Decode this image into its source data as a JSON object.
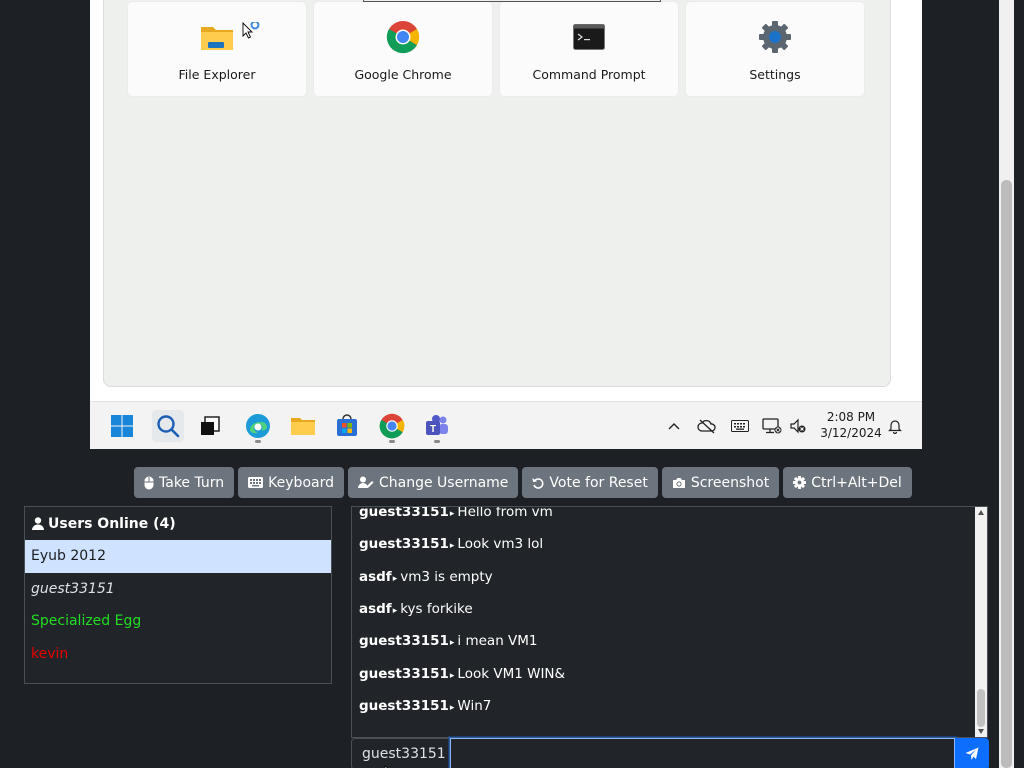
{
  "vm": {
    "pinned_apps": [
      {
        "label": "File Explorer",
        "icon": "folder-icon"
      },
      {
        "label": "Google Chrome",
        "icon": "chrome-icon"
      },
      {
        "label": "Command Prompt",
        "icon": "terminal-icon"
      },
      {
        "label": "Settings",
        "icon": "gear-icon"
      }
    ],
    "taskbar": {
      "icons": [
        "windows-start-icon",
        "search-icon",
        "task-view-icon",
        "edge-icon",
        "file-explorer-icon",
        "store-icon",
        "chrome-icon",
        "teams-icon"
      ],
      "tray_icons": [
        "chevron-up-icon",
        "cloud-off-icon",
        "keyboard-icon",
        "network-icon",
        "volume-muted-icon"
      ],
      "time": "2:08 PM",
      "date": "3/12/2024",
      "notification_icon": "bell-icon"
    }
  },
  "controls": {
    "take_turn": "Take Turn",
    "keyboard": "Keyboard",
    "change_username": "Change Username",
    "vote_reset": "Vote for Reset",
    "screenshot": "Screenshot",
    "ctrl_alt_del": "Ctrl+Alt+Del"
  },
  "users": {
    "header": "Users Online (4)",
    "list": [
      {
        "name": "Eyub 2012"
      },
      {
        "name": "guest33151"
      },
      {
        "name": "Specialized Egg"
      },
      {
        "name": "kevin"
      }
    ]
  },
  "chat": {
    "messages": [
      {
        "user": "guest33151",
        "sep": "▸",
        "text": "Hello from vm"
      },
      {
        "user": "guest33151",
        "sep": "▸",
        "text": "Look vm3 lol"
      },
      {
        "user": "asdf",
        "sep": "▸",
        "text": "vm3 is empty"
      },
      {
        "user": "asdf",
        "sep": "▸",
        "text": "kys forkike"
      },
      {
        "user": "guest33151",
        "sep": "▸",
        "text": "i mean VM1"
      },
      {
        "user": "guest33151",
        "sep": "▸",
        "text": "Look VM1 WIN&"
      },
      {
        "user": "guest33151",
        "sep": "▸",
        "text": "Win7"
      }
    ],
    "username": "guest33151",
    "input_value": "",
    "send_icon": "send-icon"
  },
  "colors": {
    "accent": "#0d6efd",
    "button_gray": "#6c757d",
    "selected_user_bg": "#cfe2ff",
    "green_user": "#22dd22",
    "red_user": "#e60000"
  }
}
